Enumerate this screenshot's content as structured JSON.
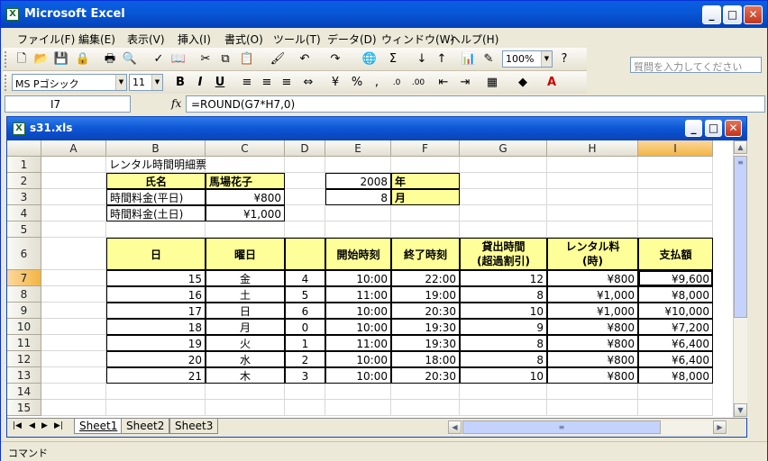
{
  "app": {
    "title": "Microsoft Excel",
    "icon": "excel-icon"
  },
  "window_buttons": {
    "minimize": "_",
    "maximize": "□",
    "close": "✕"
  },
  "menu": [
    "ファイル(F)",
    "編集(E)",
    "表示(V)",
    "挿入(I)",
    "書式(O)",
    "ツール(T)",
    "データ(D)",
    "ウィンドウ(W)",
    "ヘルプ(H)"
  ],
  "help_placeholder": "質問を入力してください",
  "toolbar": {
    "zoom": "100%",
    "font": "MS Pゴシック",
    "size": "11"
  },
  "formula_bar": {
    "name_box": "I7",
    "fx": "fx",
    "formula": "=ROUND(G7*H7,0)"
  },
  "workbook": {
    "title": "s31.xls"
  },
  "columns": [
    "A",
    "B",
    "C",
    "D",
    "E",
    "F",
    "G",
    "H",
    "I"
  ],
  "rows": [
    "1",
    "2",
    "3",
    "4",
    "5",
    "6",
    "7",
    "8",
    "9",
    "10",
    "11",
    "12",
    "13",
    "14",
    "15"
  ],
  "active_cell": "I7",
  "cells": {
    "b1": "レンタル時間明細票",
    "b2": "氏名",
    "c2": "馬場花子",
    "e2": "2008",
    "f2": "年",
    "b3": "時間料金(平日)",
    "c3": "¥800",
    "e3": "8",
    "f3": "月",
    "b4": "時間料金(土日)",
    "c4": "¥1,000",
    "h_day": "日",
    "h_dow": "曜日",
    "h_start": "開始時刻",
    "h_end": "終了時刻",
    "h_hours": "貸出時間",
    "h_hours2": "(超過割引)",
    "h_rate": "レンタル料",
    "h_rate2": "(時)",
    "h_pay": "支払額"
  },
  "table_rows": [
    {
      "day": "15",
      "dow": "金",
      "d": "4",
      "start": "10:00",
      "end": "22:00",
      "hours": "12",
      "rate": "¥800",
      "pay": "¥9,600"
    },
    {
      "day": "16",
      "dow": "土",
      "d": "5",
      "start": "11:00",
      "end": "19:00",
      "hours": "8",
      "rate": "¥1,000",
      "pay": "¥8,000"
    },
    {
      "day": "17",
      "dow": "日",
      "d": "6",
      "start": "10:00",
      "end": "20:30",
      "hours": "10",
      "rate": "¥1,000",
      "pay": "¥10,000"
    },
    {
      "day": "18",
      "dow": "月",
      "d": "0",
      "start": "10:00",
      "end": "19:30",
      "hours": "9",
      "rate": "¥800",
      "pay": "¥7,200"
    },
    {
      "day": "19",
      "dow": "火",
      "d": "1",
      "start": "11:00",
      "end": "19:30",
      "hours": "8",
      "rate": "¥800",
      "pay": "¥6,400"
    },
    {
      "day": "20",
      "dow": "水",
      "d": "2",
      "start": "10:00",
      "end": "18:00",
      "hours": "8",
      "rate": "¥800",
      "pay": "¥6,400"
    },
    {
      "day": "21",
      "dow": "木",
      "d": "3",
      "start": "10:00",
      "end": "20:30",
      "hours": "10",
      "rate": "¥800",
      "pay": "¥8,000"
    }
  ],
  "sheets": [
    "Sheet1",
    "Sheet2",
    "Sheet3"
  ],
  "active_sheet": "Sheet1",
  "status": "コマンド",
  "colors": {
    "title_blue": "#0858d8",
    "header_yellow": "#ffff99",
    "active_header": "#f2b543"
  }
}
